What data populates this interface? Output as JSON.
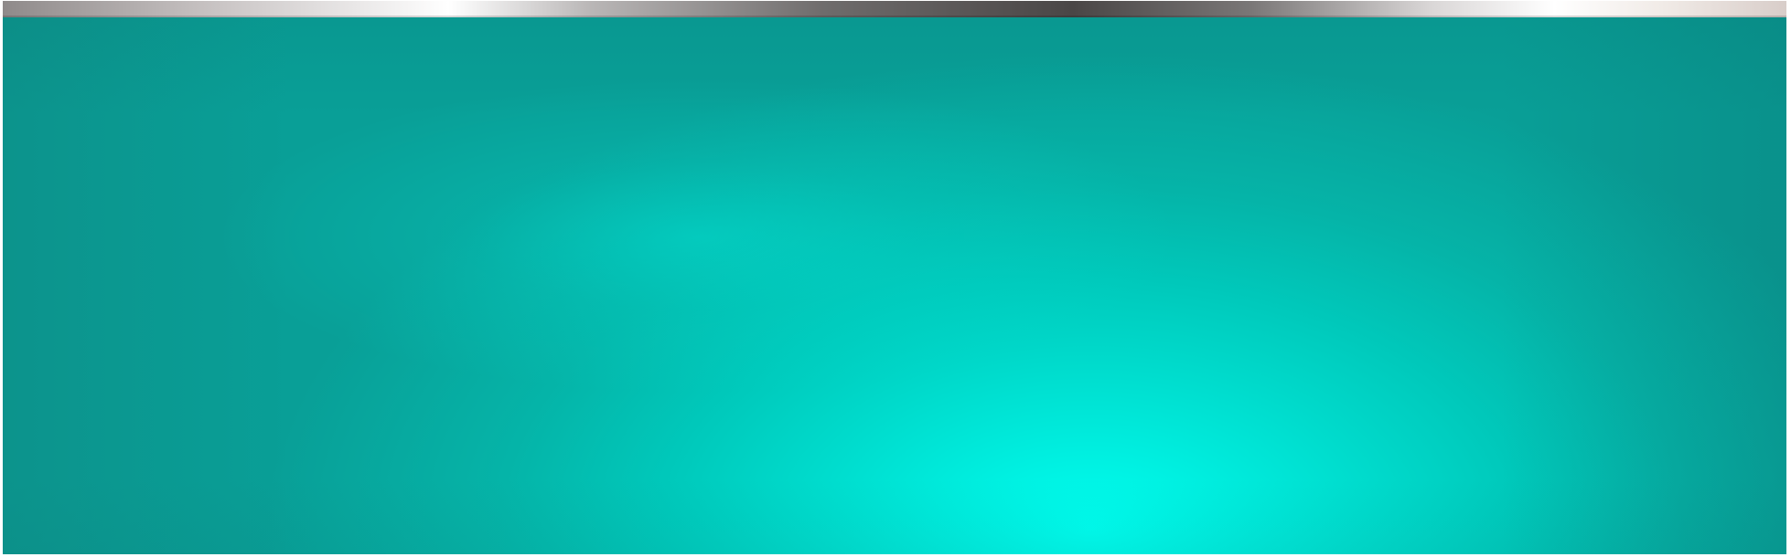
{
  "colors": {
    "top_bar": [
      "#8f8a8a",
      "#ffffff",
      "#4a4646",
      "#ffffff",
      "#d8cdc9"
    ],
    "panel_center": "#00fff0",
    "panel_edge": "#099f97",
    "background": "#ffffff"
  }
}
